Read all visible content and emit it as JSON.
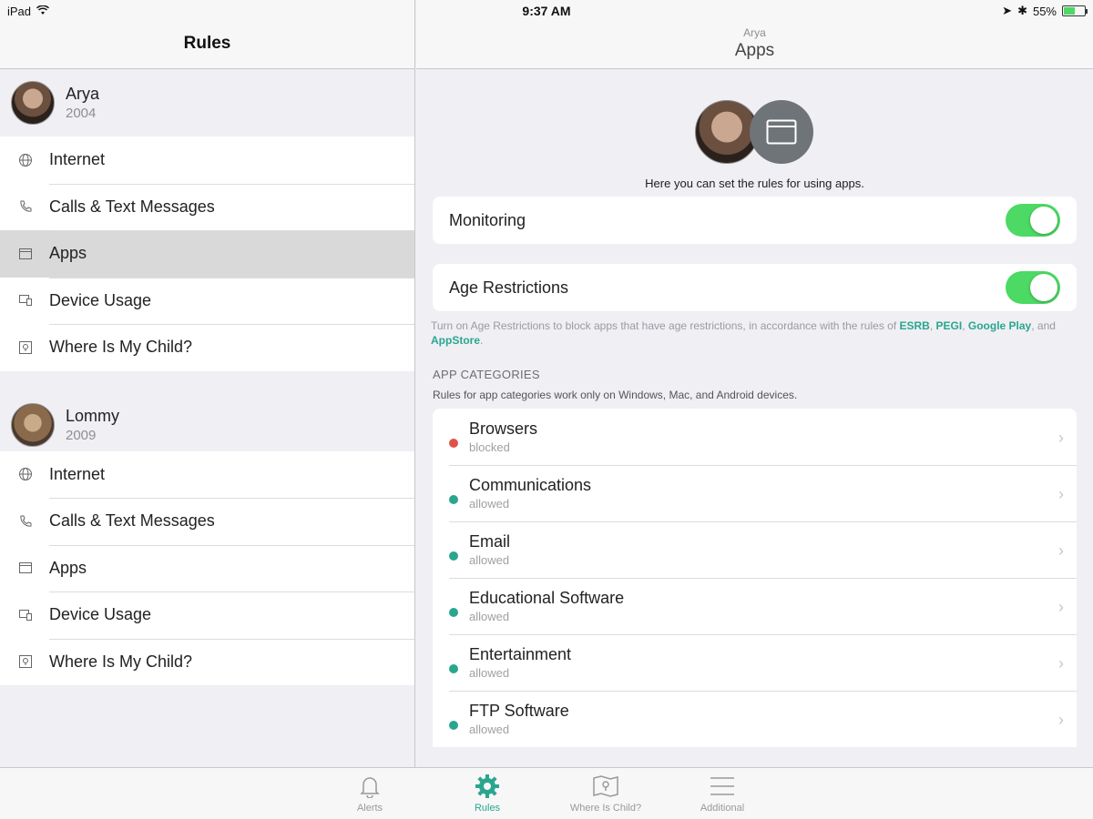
{
  "status_bar": {
    "device": "iPad",
    "time": "9:37 AM",
    "battery": "55%",
    "battery_level": 0.55
  },
  "sidebar": {
    "title": "Rules",
    "profiles": [
      {
        "name": "Arya",
        "year": "2004",
        "items": [
          {
            "label": "Internet",
            "icon": "globe-icon"
          },
          {
            "label": "Calls & Text Messages",
            "icon": "phone-icon"
          },
          {
            "label": "Apps",
            "icon": "app-window-icon",
            "selected": true
          },
          {
            "label": "Device Usage",
            "icon": "devices-icon"
          },
          {
            "label": "Where Is My Child?",
            "icon": "location-icon"
          }
        ]
      },
      {
        "name": "Lommy",
        "year": "2009",
        "items": [
          {
            "label": "Internet",
            "icon": "globe-icon"
          },
          {
            "label": "Calls & Text Messages",
            "icon": "phone-icon"
          },
          {
            "label": "Apps",
            "icon": "app-window-icon"
          },
          {
            "label": "Device Usage",
            "icon": "devices-icon"
          },
          {
            "label": "Where Is My Child?",
            "icon": "location-icon"
          }
        ]
      }
    ]
  },
  "main": {
    "header_sub": "Arya",
    "header_title": "Apps",
    "caption": "Here you can set the rules for using apps.",
    "monitoring_label": "Monitoring",
    "monitoring_on": true,
    "age_label": "Age Restrictions",
    "age_on": true,
    "note_text": "Turn on Age Restrictions to block apps that have age restrictions, in accordance with the rules of ",
    "note_links": [
      "ESRB",
      "PEGI",
      "Google Play",
      "AppStore"
    ],
    "note_sep1": ", ",
    "note_sep2": ", ",
    "note_and": ", and ",
    "note_end": ".",
    "section_title": "APP CATEGORIES",
    "section_sub": "Rules for app categories work only on Windows, Mac, and Android devices.",
    "categories": [
      {
        "name": "Browsers",
        "status": "blocked",
        "color": "#e0524a"
      },
      {
        "name": "Communications",
        "status": "allowed",
        "color": "#2aa68f"
      },
      {
        "name": "Email",
        "status": "allowed",
        "color": "#2aa68f"
      },
      {
        "name": "Educational Software",
        "status": "allowed",
        "color": "#2aa68f"
      },
      {
        "name": "Entertainment",
        "status": "allowed",
        "color": "#2aa68f"
      },
      {
        "name": "FTP Software",
        "status": "allowed",
        "color": "#2aa68f"
      }
    ]
  },
  "tabbar": {
    "tabs": [
      {
        "label": "Alerts",
        "icon": "bell-icon"
      },
      {
        "label": "Rules",
        "icon": "gear-icon",
        "active": true
      },
      {
        "label": "Where Is Child?",
        "icon": "map-icon"
      },
      {
        "label": "Additional",
        "icon": "menu-icon"
      }
    ]
  },
  "colors": {
    "accent": "#2aa68f",
    "toggle_on": "#4cd964",
    "blocked": "#e0524a"
  }
}
